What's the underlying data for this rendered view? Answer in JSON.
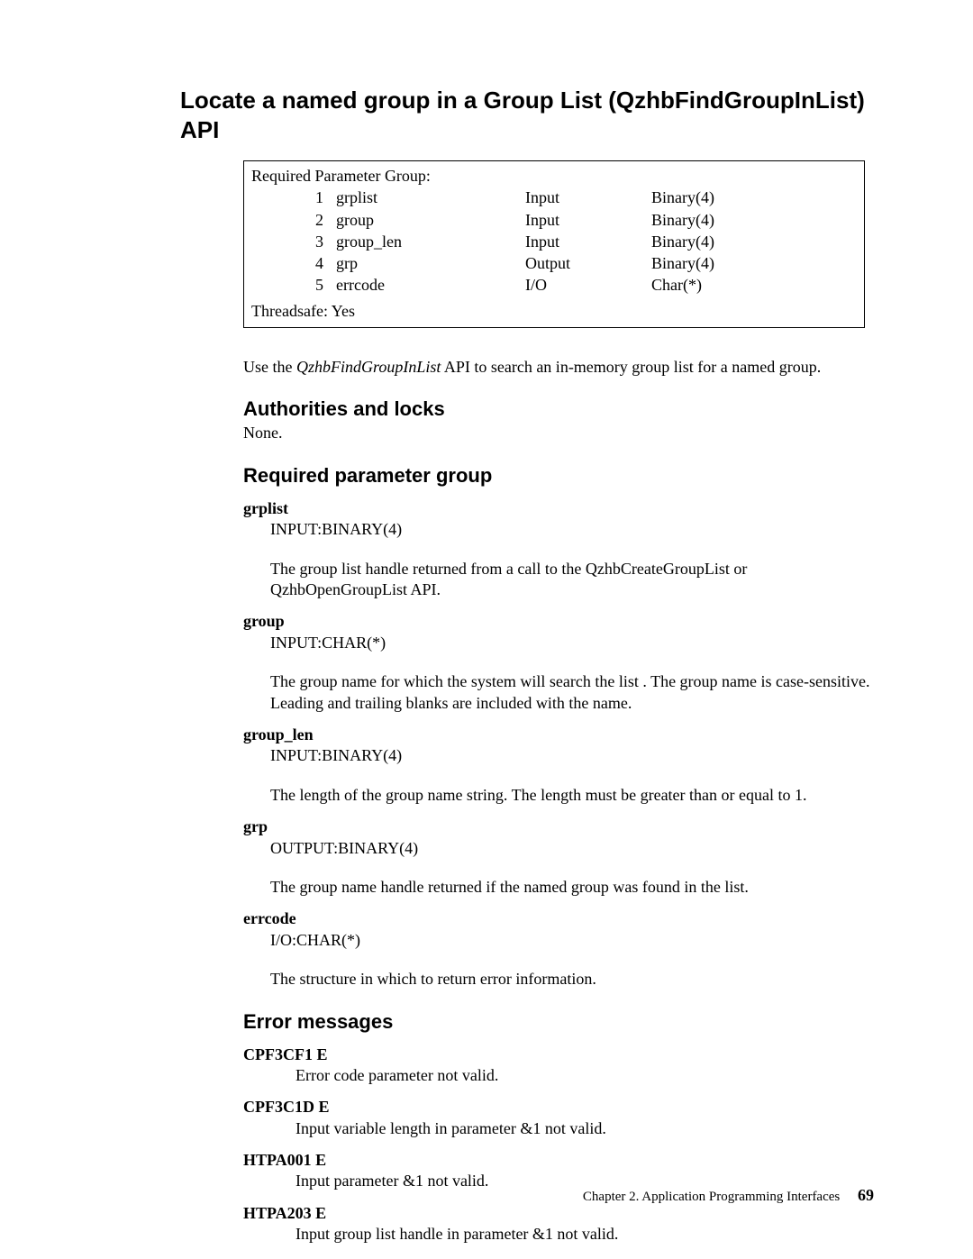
{
  "title": "Locate a named group in a Group List (QzhbFindGroupInList) API",
  "parambox": {
    "heading": "Required Parameter Group:",
    "rows": [
      {
        "num": "1",
        "name": "grplist",
        "io": "Input",
        "type": "Binary(4)"
      },
      {
        "num": "2",
        "name": "group",
        "io": "Input",
        "type": "Binary(4)"
      },
      {
        "num": "3",
        "name": "group_len",
        "io": "Input",
        "type": "Binary(4)"
      },
      {
        "num": "4",
        "name": "grp",
        "io": "Output",
        "type": "Binary(4)"
      },
      {
        "num": "5",
        "name": "errcode",
        "io": "I/O",
        "type": "Char(*)"
      }
    ],
    "threadsafe": "Threadsafe: Yes"
  },
  "intro_pre": "Use the ",
  "intro_api": "QzhbFindGroupInList",
  "intro_post": " API to search an in-memory group list for a named group.",
  "sections": {
    "authorities": {
      "title": "Authorities and locks",
      "body": "None."
    },
    "reqparam": {
      "title": "Required parameter group",
      "items": [
        {
          "name": "grplist",
          "type": "INPUT:BINARY(4)",
          "desc": "The group list handle returned from a call to the QzhbCreateGroupList or QzhbOpenGroupList API."
        },
        {
          "name": "group",
          "type": "INPUT:CHAR(*)",
          "desc": "The group name for which the system will search the list . The group name is case-sensitive. Leading and trailing blanks are included with the name."
        },
        {
          "name": "group_len",
          "type": "INPUT:BINARY(4)",
          "desc": "The length of the group name string. The length must be greater than or equal to 1."
        },
        {
          "name": "grp",
          "type": "OUTPUT:BINARY(4)",
          "desc": "The group name handle returned if the named group was found in the list."
        },
        {
          "name": "errcode",
          "type": "I/O:CHAR(*)",
          "desc": "The structure in which to return error information."
        }
      ]
    },
    "errors": {
      "title": "Error messages",
      "items": [
        {
          "code": "CPF3CF1 E",
          "msg": "Error code parameter not valid."
        },
        {
          "code": "CPF3C1D E",
          "msg": "Input variable length in parameter &1 not valid."
        },
        {
          "code": "HTPA001 E",
          "msg": "Input parameter &1 not valid."
        },
        {
          "code": "HTPA203 E",
          "msg": "Input group list handle in parameter &1 not valid."
        }
      ]
    }
  },
  "footer": {
    "chapter": "Chapter 2. Application Programming Interfaces",
    "page": "69"
  }
}
